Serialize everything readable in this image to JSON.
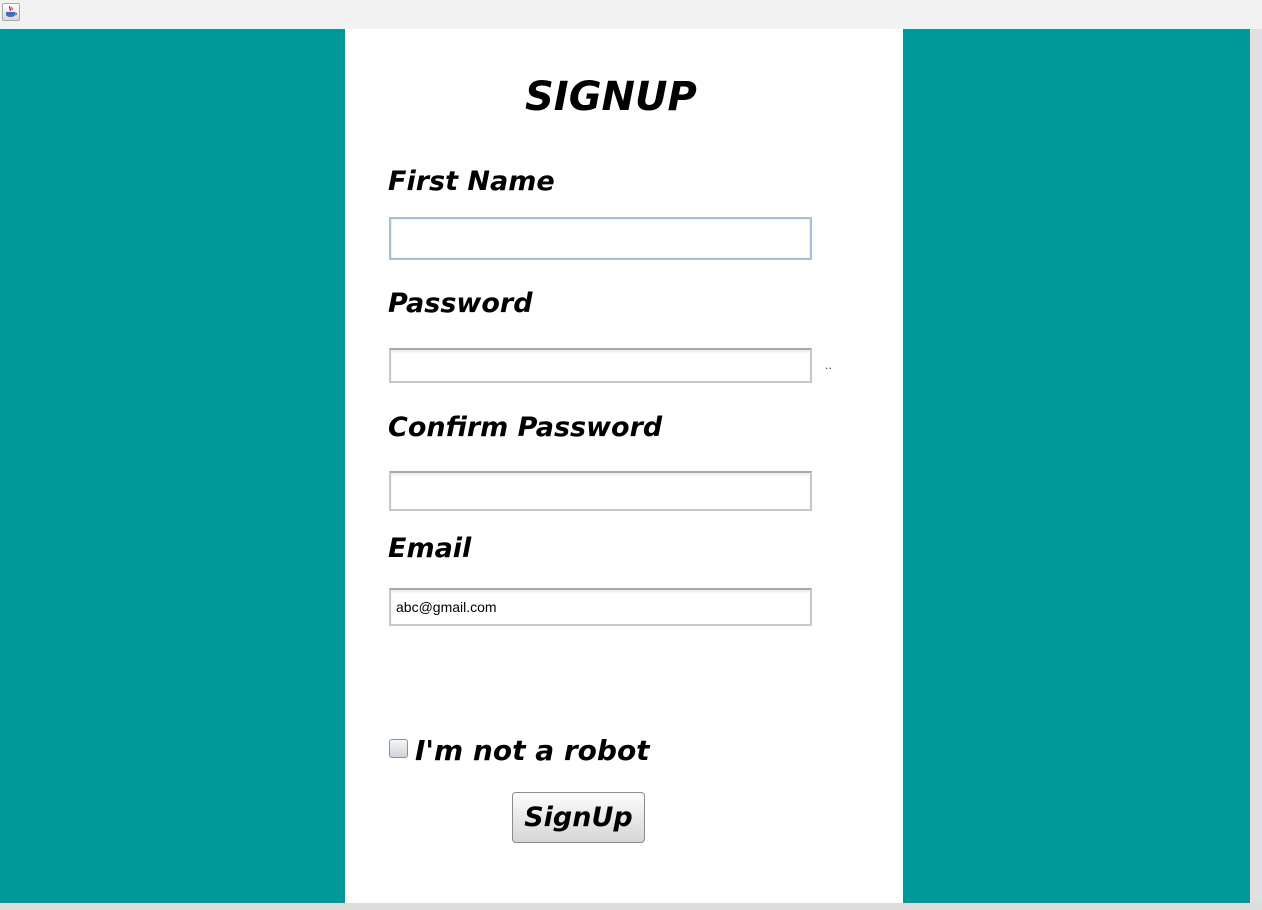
{
  "window": {
    "icon": "java-coffee-cup-icon"
  },
  "colors": {
    "background": "#009999",
    "panel": "#ffffff",
    "focus_border": "#a9bed7"
  },
  "form": {
    "title": "SIGNUP",
    "first_name_label": "First Name",
    "first_name_value": "",
    "password_label": "Password",
    "password_value": "",
    "password_indicator": "..",
    "confirm_password_label": "Confirm Password",
    "confirm_password_value": "",
    "email_label": "Email",
    "email_value": "abc@gmail.com",
    "robot_label": "I'm not a robot",
    "robot_checked": false,
    "submit_label": "SignUp"
  }
}
